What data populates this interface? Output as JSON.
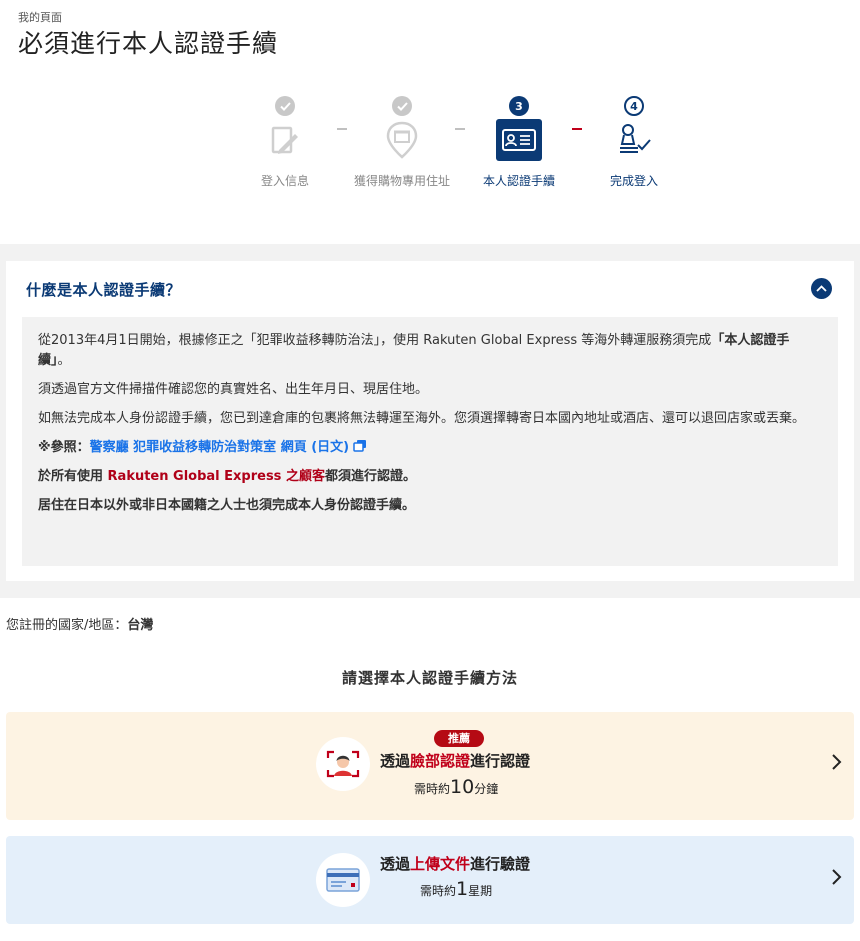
{
  "breadcrumb": "我的頁面",
  "page_title": "必須進行本人認證手續",
  "steps": [
    {
      "number": "✓",
      "label": "登入信息"
    },
    {
      "number": "✓",
      "label": "獲得購物專用住址"
    },
    {
      "number": "3",
      "label": "本人認證手續"
    },
    {
      "number": "4",
      "label": "完成登入"
    }
  ],
  "faq": {
    "title": "什麼是本人認證手續？",
    "p1_start": "從2013年4月1日開始，根據修正之「犯罪收益移轉防治法」，使用 Rakuten Global Express 等海外轉運服務須完成",
    "p1_bold": "「本人認證手續」",
    "p1_end": "。",
    "p2": "須透過官方文件掃描件確認您的真實姓名、出生年月日、現居住地。",
    "p3": "如無法完成本人身份認證手續，您已到達倉庫的包裹將無法轉運至海外。您須選擇轉寄日本國內地址或酒店、還可以退回店家或丟棄。",
    "ref_label": "※參照：",
    "ref_link": "警察廳 犯罪收益移轉防治對策室 網頁 (日文)",
    "p5_start": "於所有使用 ",
    "p5_highlight": "Rakuten Global Express 之顧客",
    "p5_end": "都須進行認證。",
    "p6": "居住在日本以外或非日本國籍之人士也須完成本人身份認證手續。"
  },
  "country": {
    "label": "您註冊的國家/地區：",
    "value": "台灣"
  },
  "method_heading": "請選擇本人認證手續方法",
  "methods": [
    {
      "badge": "推薦",
      "title_pre": "透過",
      "title_highlight": "臉部認證",
      "title_post": "進行認證",
      "time_pre": "需時約",
      "time_num": "10",
      "time_unit": "分鐘"
    },
    {
      "title_pre": "透過",
      "title_highlight": "上傳文件",
      "title_post": "進行驗證",
      "time_pre": "需時約",
      "time_num": "1",
      "time_unit": "星期"
    }
  ],
  "colors": {
    "primary": "#0b3a75",
    "accent_red": "#c0001a",
    "link": "#1a73e8",
    "face_card_bg": "#fdf3e3",
    "doc_card_bg": "#e4effa"
  }
}
